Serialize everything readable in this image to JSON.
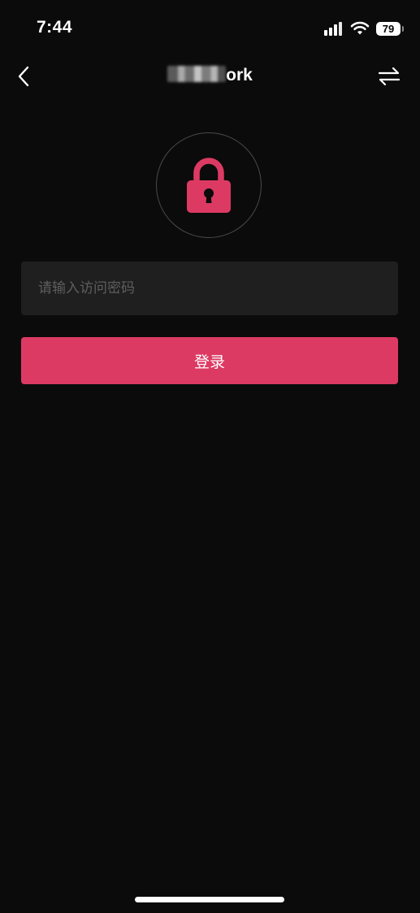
{
  "status_bar": {
    "time": "7:44",
    "battery_level": "79",
    "icons": [
      "signal-icon",
      "wifi-icon",
      "battery-icon"
    ]
  },
  "nav": {
    "title_suffix": "ork",
    "back_icon": "chevron-left-icon",
    "switch_icon": "swap-arrows-icon"
  },
  "login": {
    "lock_icon": "lock-icon",
    "password_placeholder": "请输入访问密码",
    "password_value": "",
    "submit_label": "登录"
  },
  "colors": {
    "background": "#0b0b0b",
    "accent": "#dc3a63",
    "input_background": "#1f1f1f",
    "placeholder": "#5e5e5e",
    "circle_border": "#4a4a4a"
  }
}
